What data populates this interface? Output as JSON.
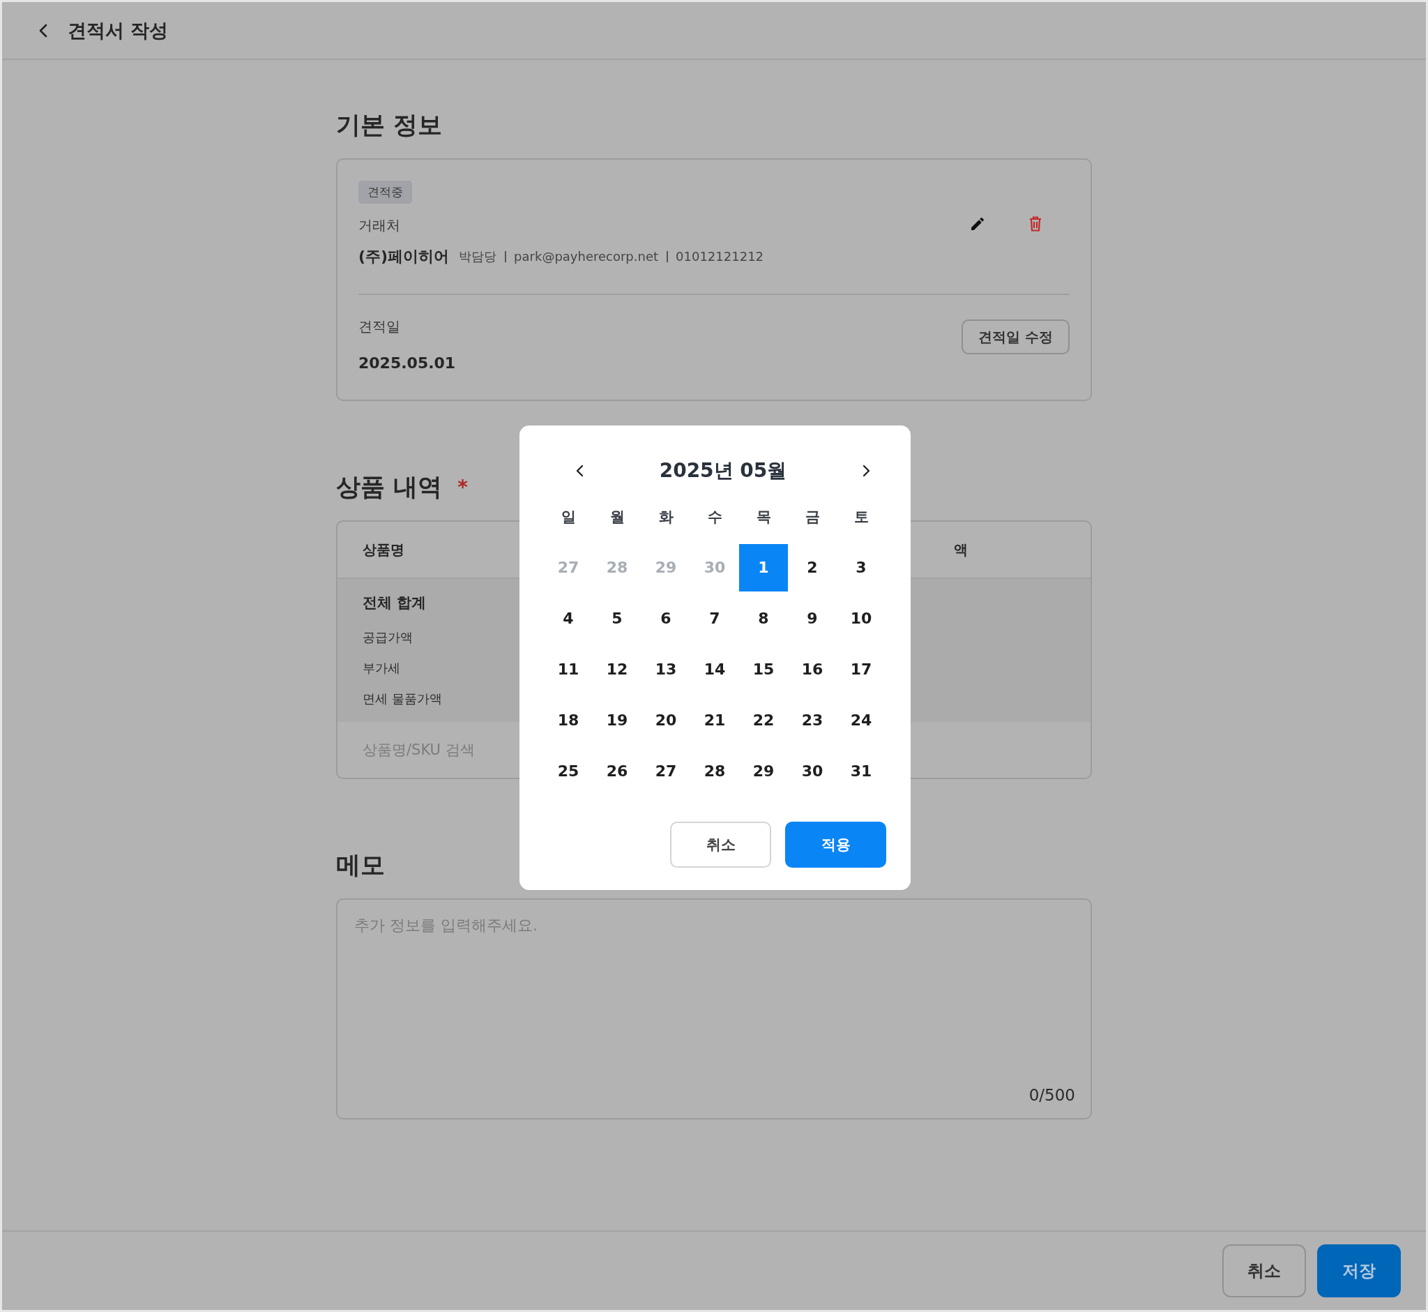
{
  "header": {
    "title": "견적서 작성"
  },
  "basic_info": {
    "heading": "기본 정보",
    "status_badge": "견적중",
    "client_label": "거래처",
    "client_name": "(주)페이히어",
    "client_details": [
      "박담당",
      "park@payherecorp.net",
      "01012121212"
    ],
    "date_label": "견적일",
    "date_value": "2025.05.01",
    "edit_date_button": "견적일 수정"
  },
  "products": {
    "heading": "상품 내역",
    "required_mark": "*",
    "columns": [
      "상품명",
      "액"
    ],
    "total_label": "전체 합계",
    "summary_rows": [
      "공급가액",
      "부가세",
      "면세 물품가액"
    ],
    "search": {
      "placeholder": "상품명/SKU 검색"
    }
  },
  "memo": {
    "heading": "메모",
    "placeholder": "추가 정보를 입력해주세요.",
    "count": "0/500"
  },
  "footer": {
    "buttons": [
      {
        "label": "취소",
        "kind": "secondary"
      },
      {
        "label": "저장",
        "kind": "primary"
      }
    ]
  },
  "date_picker": {
    "title": "2025년 05월",
    "weekdays": [
      "일",
      "월",
      "화",
      "수",
      "목",
      "금",
      "토"
    ],
    "days": [
      {
        "label": "27",
        "outside": true,
        "selected": false
      },
      {
        "label": "28",
        "outside": true,
        "selected": false
      },
      {
        "label": "29",
        "outside": true,
        "selected": false
      },
      {
        "label": "30",
        "outside": true,
        "selected": false
      },
      {
        "label": "1",
        "outside": false,
        "selected": true
      },
      {
        "label": "2",
        "outside": false,
        "selected": false
      },
      {
        "label": "3",
        "outside": false,
        "selected": false
      },
      {
        "label": "4",
        "outside": false,
        "selected": false
      },
      {
        "label": "5",
        "outside": false,
        "selected": false
      },
      {
        "label": "6",
        "outside": false,
        "selected": false
      },
      {
        "label": "7",
        "outside": false,
        "selected": false
      },
      {
        "label": "8",
        "outside": false,
        "selected": false
      },
      {
        "label": "9",
        "outside": false,
        "selected": false
      },
      {
        "label": "10",
        "outside": false,
        "selected": false
      },
      {
        "label": "11",
        "outside": false,
        "selected": false
      },
      {
        "label": "12",
        "outside": false,
        "selected": false
      },
      {
        "label": "13",
        "outside": false,
        "selected": false
      },
      {
        "label": "14",
        "outside": false,
        "selected": false
      },
      {
        "label": "15",
        "outside": false,
        "selected": false
      },
      {
        "label": "16",
        "outside": false,
        "selected": false
      },
      {
        "label": "17",
        "outside": false,
        "selected": false
      },
      {
        "label": "18",
        "outside": false,
        "selected": false
      },
      {
        "label": "19",
        "outside": false,
        "selected": false
      },
      {
        "label": "20",
        "outside": false,
        "selected": false
      },
      {
        "label": "21",
        "outside": false,
        "selected": false
      },
      {
        "label": "22",
        "outside": false,
        "selected": false
      },
      {
        "label": "23",
        "outside": false,
        "selected": false
      },
      {
        "label": "24",
        "outside": false,
        "selected": false
      },
      {
        "label": "25",
        "outside": false,
        "selected": false
      },
      {
        "label": "26",
        "outside": false,
        "selected": false
      },
      {
        "label": "27",
        "outside": false,
        "selected": false
      },
      {
        "label": "28",
        "outside": false,
        "selected": false
      },
      {
        "label": "29",
        "outside": false,
        "selected": false
      },
      {
        "label": "30",
        "outside": false,
        "selected": false
      },
      {
        "label": "31",
        "outside": false,
        "selected": false
      }
    ],
    "buttons": [
      {
        "label": "취소",
        "kind": "secondary"
      },
      {
        "label": "적용",
        "kind": "primary"
      }
    ]
  }
}
